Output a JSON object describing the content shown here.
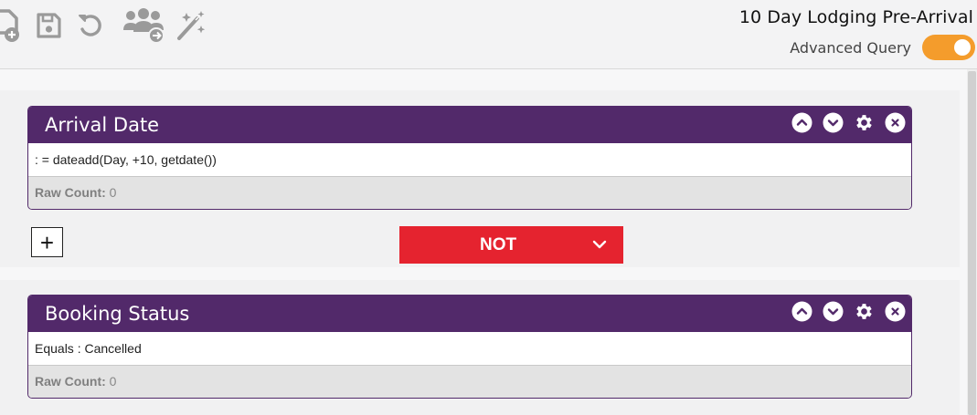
{
  "toolbar": {
    "icons": [
      "add-query-icon",
      "save-icon",
      "undo-icon",
      "assign-users-icon",
      "magic-wand-icon"
    ],
    "query_title": "10 Day Lodging Pre-Arrival",
    "advanced_query_label": "Advanced Query",
    "advanced_query_enabled": true,
    "toggle_color": "#f49c2c"
  },
  "filters": [
    {
      "title": "Arrival Date",
      "condition": ": = dateadd(Day, +10, getdate())",
      "raw_count_label": "Raw Count:",
      "raw_count_value": "0",
      "actions": [
        "chevron-up-icon",
        "chevron-down-icon",
        "gear-icon",
        "close-icon"
      ]
    },
    {
      "title": "Booking Status",
      "condition": "Equals : Cancelled",
      "raw_count_label": "Raw Count:",
      "raw_count_value": "0",
      "actions": [
        "chevron-up-icon",
        "chevron-down-icon",
        "gear-icon",
        "close-icon"
      ]
    }
  ],
  "connector": {
    "add_symbol": "+",
    "operator_label": "NOT",
    "operator_color": "#e5232f"
  },
  "colors": {
    "header_purple": "#52296a",
    "count_bg": "#e3e3e3"
  }
}
